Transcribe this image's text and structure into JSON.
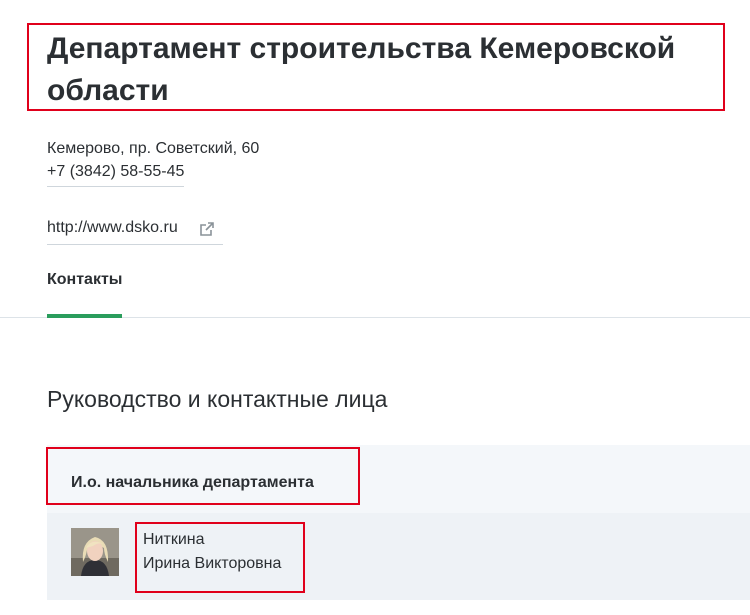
{
  "organization": {
    "title": "Департамент строительства Кемеровской области",
    "address": "Кемерово, пр. Советский, 60",
    "phone": "+7 (3842) 58-55-45",
    "website": "http://www.dsko.ru",
    "website_icon": "external-link-icon"
  },
  "tabs": [
    {
      "label": "Контакты",
      "active": true
    }
  ],
  "leadership": {
    "section_title": "Руководство и контактные лица",
    "position": "И.о. начальника департамента",
    "person": {
      "last_name": "Ниткина",
      "first_middle_name": "Ирина Викторовна"
    }
  },
  "colors": {
    "accent": "#2a9d5c",
    "highlight": "#e0001b",
    "card_bg": "#f4f7fa",
    "text": "#2b2f33"
  }
}
